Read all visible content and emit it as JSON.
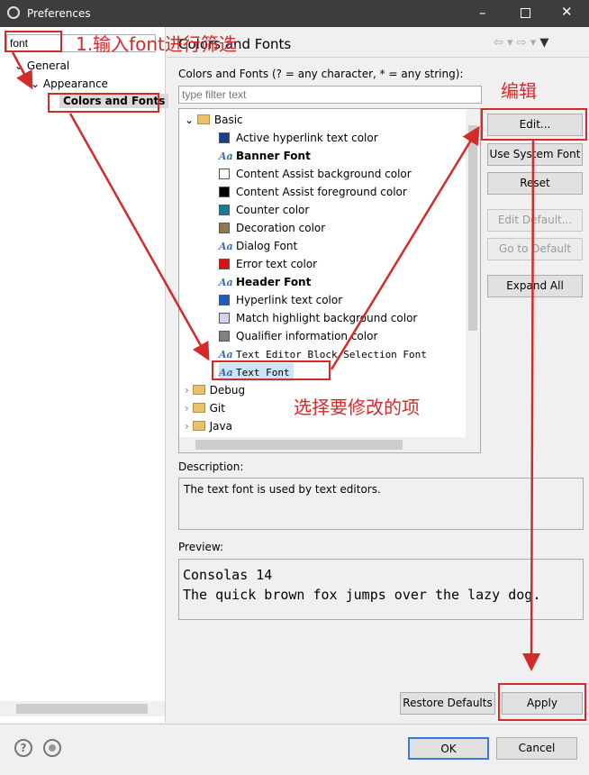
{
  "window": {
    "title": "Preferences",
    "minimize_icon": "minimize-icon",
    "maximize_icon": "maximize-icon",
    "close_icon": "close-icon"
  },
  "left": {
    "search_value": "font",
    "tree": [
      {
        "label": "General"
      },
      {
        "label": "Appearance"
      },
      {
        "label": "Colors and Fonts"
      }
    ]
  },
  "main": {
    "page_title": "Colors and Fonts",
    "filter_label": "Colors and Fonts (? = any character, * = any string):",
    "filter_placeholder": "type filter text",
    "tree": {
      "basic": "Basic",
      "items": [
        {
          "label": "Active hyperlink text color",
          "kind": "color",
          "color": "#1c3f8a"
        },
        {
          "label": "Banner Font",
          "kind": "font",
          "bold": true
        },
        {
          "label": "Content Assist background color",
          "kind": "color",
          "color": "#ffffff"
        },
        {
          "label": "Content Assist foreground color",
          "kind": "color",
          "color": "#000000"
        },
        {
          "label": "Counter color",
          "kind": "color",
          "color": "#1a7a9a"
        },
        {
          "label": "Decoration color",
          "kind": "color",
          "color": "#8e7a4e"
        },
        {
          "label": "Dialog Font",
          "kind": "font"
        },
        {
          "label": "Error text color",
          "kind": "color",
          "color": "#e01010"
        },
        {
          "label": "Header Font",
          "kind": "font",
          "bold": true
        },
        {
          "label": "Hyperlink text color",
          "kind": "color",
          "color": "#1a5fbf"
        },
        {
          "label": "Match highlight background color",
          "kind": "color",
          "color": "#d4d4f0"
        },
        {
          "label": "Qualifier information color",
          "kind": "color",
          "color": "#808080"
        },
        {
          "label": "Text Editor Block Selection Font",
          "kind": "font",
          "mono": true
        },
        {
          "label": "Text Font",
          "kind": "font",
          "mono": true,
          "selected": true
        }
      ],
      "groups": [
        "Debug",
        "Git",
        "Java"
      ]
    },
    "buttons": {
      "edit": "Edit...",
      "use_system_font": "Use System Font",
      "reset": "Reset",
      "edit_default": "Edit Default...",
      "go_to_default": "Go to Default",
      "expand_all": "Expand All"
    },
    "description_label": "Description:",
    "description": "The text font is used by text editors.",
    "preview_label": "Preview:",
    "preview_lines": [
      "Consolas 14",
      "The quick brown fox jumps over the lazy dog."
    ],
    "restore_defaults": "Restore Defaults",
    "apply": "Apply"
  },
  "footer": {
    "ok": "OK",
    "cancel": "Cancel"
  },
  "annotations": {
    "step1": "1.输入font进行筛选",
    "edit": "编辑",
    "select": "选择要修改的项",
    "color": "#d52a2a"
  }
}
